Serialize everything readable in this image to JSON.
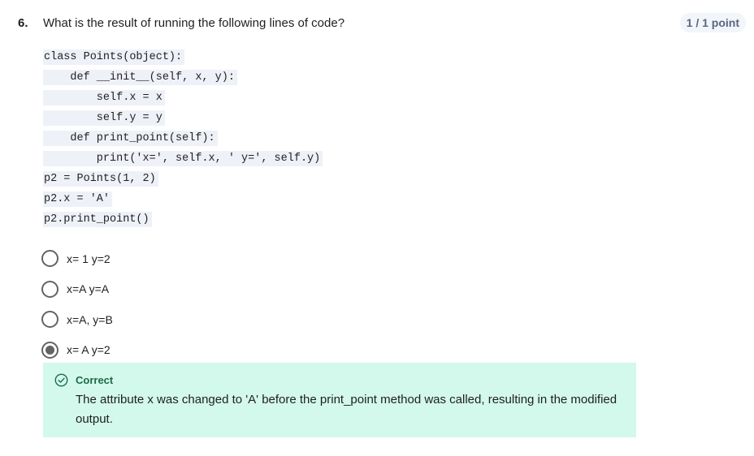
{
  "question": {
    "number": "6.",
    "text": "What is the result of running the following lines of code?",
    "points": "1 / 1 point"
  },
  "code_lines": [
    "class Points(object):",
    "    def __init__(self, x, y):",
    "        self.x = x",
    "        self.y = y",
    "    def print_point(self):",
    "        print('x=', self.x, ' y=', self.y)",
    "p2 = Points(1, 2)",
    "p2.x = 'A'",
    "p2.print_point()"
  ],
  "options": [
    {
      "label": "x= 1 y=2",
      "selected": false
    },
    {
      "label": "x=A y=A",
      "selected": false
    },
    {
      "label": "x=A, y=B",
      "selected": false
    },
    {
      "label": "x= A y=2",
      "selected": true
    }
  ],
  "feedback": {
    "title": "Correct",
    "text": "The attribute x was changed to 'A' before the print_point method was called, resulting in the modified output."
  },
  "colors": {
    "feedback_bg": "#d3f8ec",
    "feedback_accent": "#1b6b4a",
    "code_bg": "#eef1f8"
  }
}
